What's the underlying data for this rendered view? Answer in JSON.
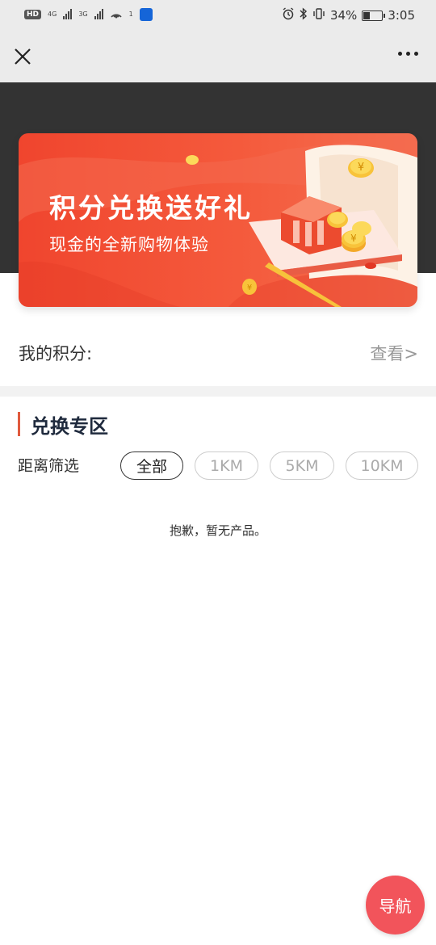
{
  "status_bar": {
    "hd": "HD",
    "sim1": "1",
    "net1": "4G",
    "net2": "3G",
    "hotspot_count": "1",
    "battery": "34%",
    "battery_level": 0.34,
    "time": "3:05",
    "icons": [
      "alarm-icon",
      "bluetooth-icon",
      "vibrate-icon",
      "battery-icon"
    ]
  },
  "nav": {
    "close_icon": "close-icon",
    "more_icon": "more-icon"
  },
  "banner": {
    "title": "积分兑换送好礼",
    "subtitle": "现金的全新购物体验",
    "coin_symbol": "¥"
  },
  "points": {
    "label": "我的积分:",
    "view": "查看>"
  },
  "section": {
    "title": "兑换专区"
  },
  "filter": {
    "label": "距离筛选",
    "options": [
      "全部",
      "1KM",
      "5KM",
      "10KM"
    ],
    "selected": "全部"
  },
  "empty_message": "抱歉，暂无产品。",
  "fab": {
    "label": "导航"
  },
  "colors": {
    "banner_red": "#f0452e",
    "fab": "#f2545b",
    "section_accent": "#e05a3e",
    "dark_band": "#333333"
  }
}
